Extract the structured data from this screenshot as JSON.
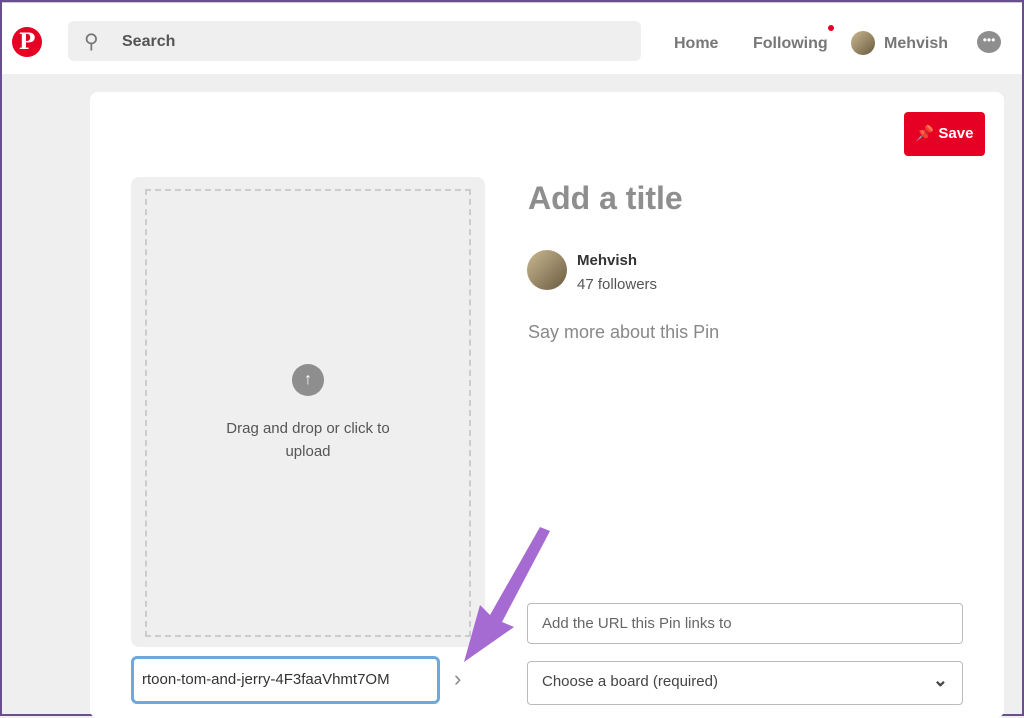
{
  "header": {
    "search_placeholder": "Search",
    "nav": [
      "Home",
      "Following"
    ],
    "user": "Mehvish"
  },
  "pin": {
    "save_label": "Save",
    "upload_text": "Drag and drop or click to upload",
    "url_value": "rtoon-tom-and-jerry-4F3faaVhmt7OM",
    "title_placeholder": "Add a title",
    "user_name": "Mehvish",
    "followers": "47 followers",
    "description_placeholder": "Say more about this Pin",
    "link_placeholder": "Add the URL this Pin links to",
    "board_select": "Choose a board (required)"
  },
  "colors": {
    "brand": "#e60023",
    "annotation_arrow": "#a66bd3"
  }
}
